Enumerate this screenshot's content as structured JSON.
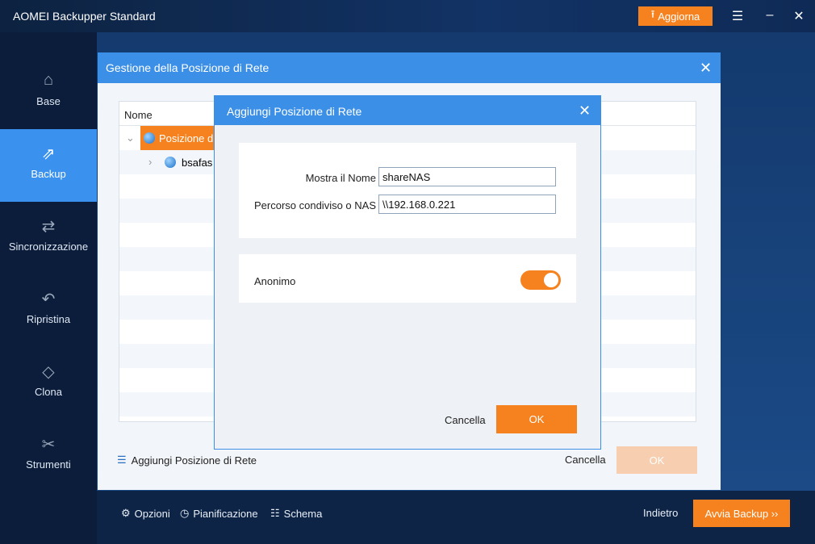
{
  "app": {
    "title": "AOMEI Backupper Standard",
    "upgrade": "Aggiorna"
  },
  "sidebar": {
    "items": [
      {
        "label": "Base",
        "icon": "home-monitor-icon"
      },
      {
        "label": "Backup",
        "icon": "backup-monitor-icon",
        "active": true
      },
      {
        "label": "Sincronizzazione",
        "icon": "sync-monitor-icon"
      },
      {
        "label": "Ripristina",
        "icon": "restore-monitor-icon"
      },
      {
        "label": "Clona",
        "icon": "clone-monitor-icon"
      },
      {
        "label": "Strumenti",
        "icon": "tools-monitor-icon"
      }
    ]
  },
  "bottom": {
    "options": "Opzioni",
    "schedule": "Pianificazione",
    "scheme": "Schema",
    "back": "Indietro",
    "start": "Avvia Backup ››"
  },
  "outer_dialog": {
    "title": "Gestione della Posizione di Rete",
    "column": "Nome",
    "tree": [
      {
        "label": "Posizione di",
        "expanded": true
      },
      {
        "label": "bsafas"
      }
    ],
    "add": "Aggiungi Posizione di Rete",
    "cancel": "Cancella",
    "ok": "OK"
  },
  "inner_dialog": {
    "title": "Aggiungi Posizione di Rete",
    "name_label": "Mostra il Nome",
    "name_value": "shareNAS",
    "path_label": "Percorso condiviso o  NAS",
    "path_value": "\\\\192.168.0.221",
    "anon_label": "Anonimo",
    "anon_on": true,
    "cancel": "Cancella",
    "ok": "OK"
  },
  "colors": {
    "accent": "#f5821f",
    "header": "#3c8fe6",
    "nav_active": "#3b92ee"
  }
}
